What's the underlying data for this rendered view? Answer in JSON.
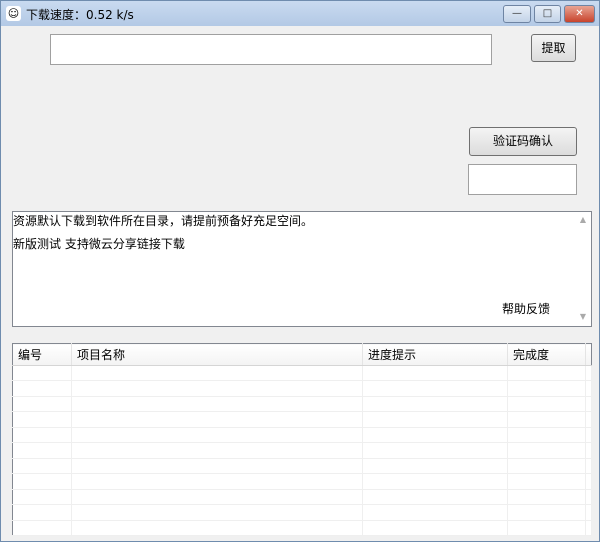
{
  "window": {
    "title": "下载速度：0.52 k/s",
    "minimize": "▭",
    "maximize": "▢",
    "close": "✕"
  },
  "fetch_button": "提取",
  "url_input": {
    "value": "",
    "placeholder": ""
  },
  "captcha_button": "验证码确认",
  "captcha_input": {
    "value": ""
  },
  "notice": {
    "lines": [
      "资源默认下载到软件所在目录，请提前预备好充足空间。",
      "新版测试 支持微云分享链接下载"
    ],
    "help_link": "帮助反馈"
  },
  "table": {
    "columns": [
      "编号",
      "项目名称",
      "进度提示",
      "完成度"
    ],
    "rows": []
  }
}
